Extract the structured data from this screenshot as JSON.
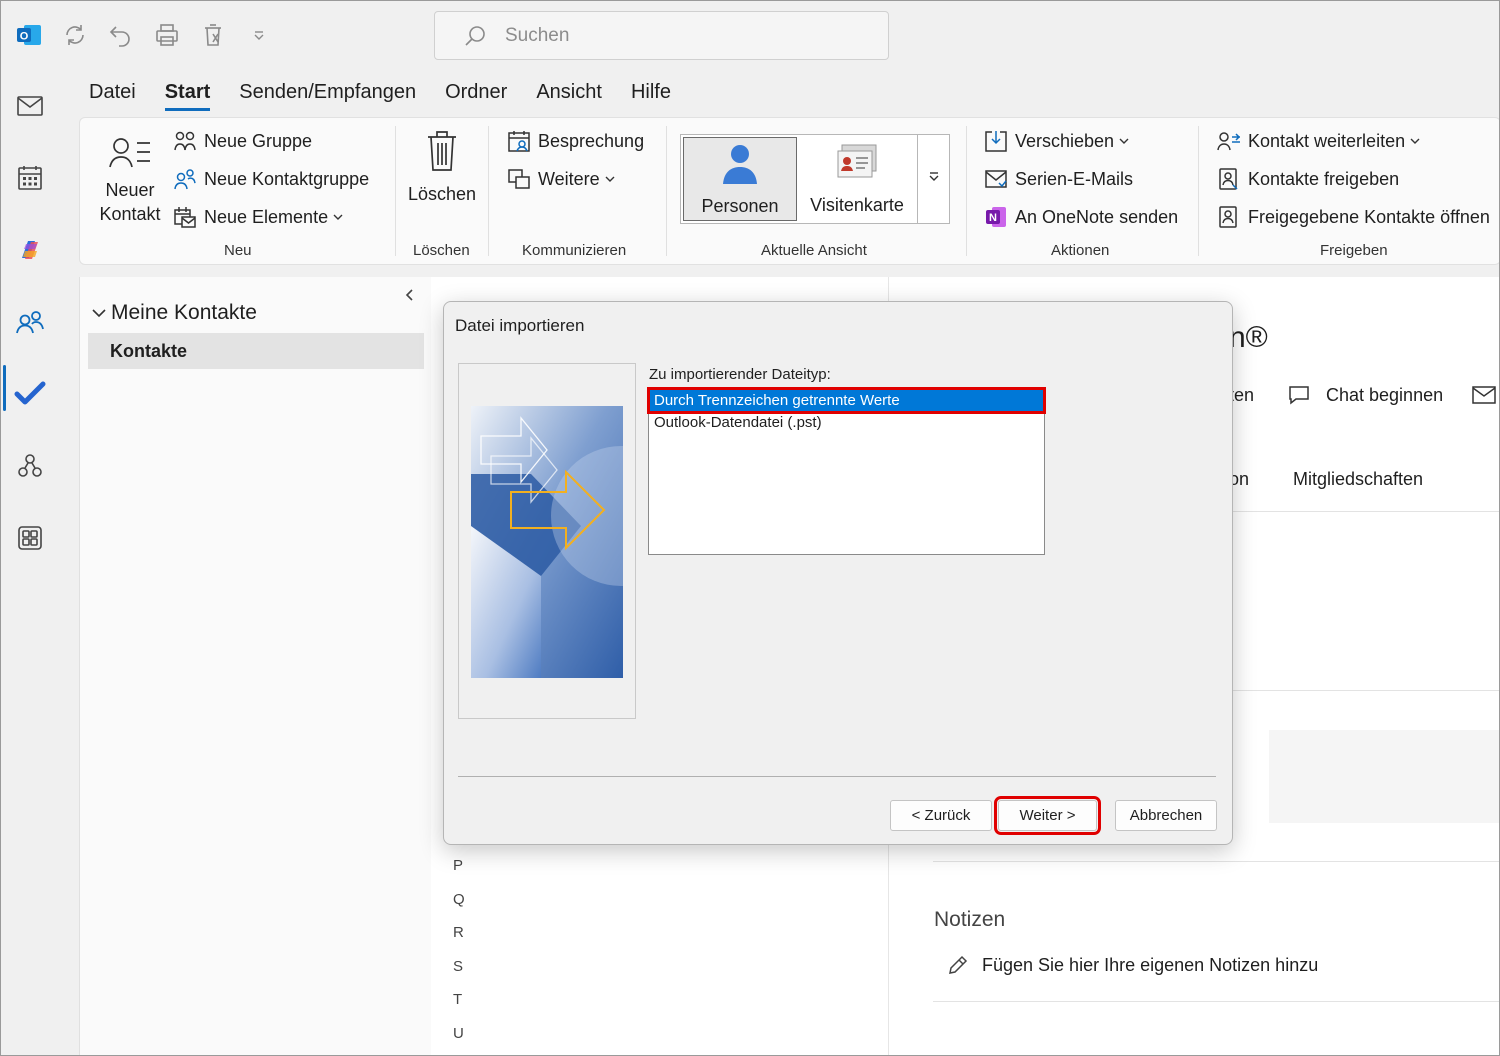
{
  "titlebar": {
    "search_placeholder": "Suchen"
  },
  "menu": {
    "tabs": [
      "Datei",
      "Start",
      "Senden/Empfangen",
      "Ordner",
      "Ansicht",
      "Hilfe"
    ],
    "active": "Start"
  },
  "ribbon": {
    "neu": {
      "new_contact_line1": "Neuer",
      "new_contact_line2": "Kontakt",
      "new_group": "Neue Gruppe",
      "new_contact_group": "Neue Kontaktgruppe",
      "new_items": "Neue Elemente",
      "label": "Neu"
    },
    "loeschen": {
      "delete": "Löschen",
      "label": "Löschen"
    },
    "kommunizieren": {
      "meeting": "Besprechung",
      "more": "Weitere",
      "label": "Kommunizieren"
    },
    "ansicht": {
      "people": "Personen",
      "business_card": "Visitenkarte",
      "label": "Aktuelle Ansicht"
    },
    "aktionen": {
      "move": "Verschieben",
      "mail_merge": "Serien-E-Mails",
      "onenote": "An OneNote senden",
      "label": "Aktionen"
    },
    "freigeben": {
      "forward": "Kontakt weiterleiten",
      "share": "Kontakte freigeben",
      "open_shared": "Freigegebene Kontakte öffnen",
      "label": "Freigeben"
    }
  },
  "folders": {
    "header": "Meine Kontakte",
    "selected": "Kontakte"
  },
  "list": {
    "letters": [
      "P",
      "Q",
      "R",
      "S",
      "T",
      "U"
    ]
  },
  "reading": {
    "name_fragment": "n®",
    "action_fragment": "ten",
    "chat": "Chat beginnen",
    "tab_fragment": "on",
    "memberships": "Mitgliedschaften",
    "notes_title": "Notizen",
    "notes_placeholder": "Fügen Sie hier Ihre eigenen Notizen hinzu"
  },
  "dialog": {
    "title": "Datei importieren",
    "list_label": "Zu importierender Dateityp:",
    "options": [
      "Durch Trennzeichen getrennte Werte",
      "Outlook-Datendatei (.pst)"
    ],
    "selected_option": "Durch Trennzeichen getrennte Werte",
    "back": "< Zurück",
    "next": "Weiter >",
    "cancel": "Abbrechen"
  },
  "colors": {
    "accent": "#0f6cbd",
    "highlight": "#e00000",
    "selection": "#0078d7"
  }
}
